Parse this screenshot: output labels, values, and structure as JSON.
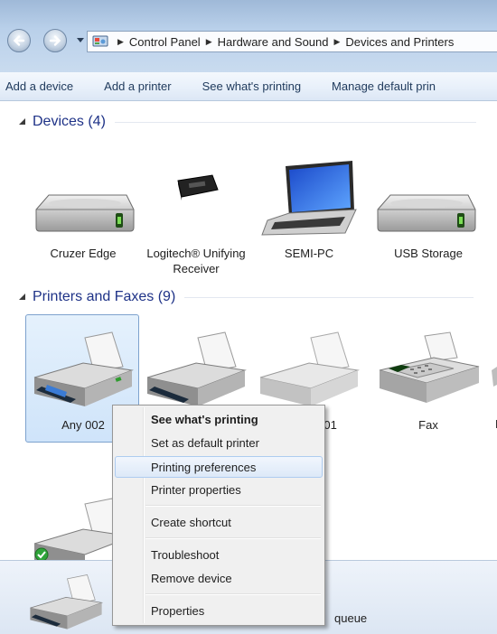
{
  "address_bar": {
    "crumbs": [
      "Control Panel",
      "Hardware and Sound",
      "Devices and Printers"
    ]
  },
  "command_bar": {
    "items": [
      "Add a device",
      "Add a printer",
      "See what's printing",
      "Manage default prin"
    ]
  },
  "devices_group": {
    "header": "Devices (4)",
    "items": [
      {
        "label": "Cruzer Edge",
        "icon": "usb-drive-icon"
      },
      {
        "label": "Logitech® Unifying Receiver",
        "icon": "usb-receiver-icon"
      },
      {
        "label": "SEMI-PC",
        "icon": "laptop-icon"
      },
      {
        "label": "USB Storage",
        "icon": "usb-drive-icon"
      }
    ]
  },
  "printers_group": {
    "header": "Printers and Faxes (9)",
    "items": [
      {
        "label": "Any 002",
        "icon": "printer-icon",
        "selected": true
      },
      {
        "label": "",
        "icon": "printer-icon"
      },
      {
        "label": "001",
        "icon": "printer-icon"
      },
      {
        "label": "Fax",
        "icon": "fax-icon"
      },
      {
        "label": "F",
        "icon": "printer-icon"
      }
    ]
  },
  "context_menu": {
    "items": [
      {
        "label": "See what's printing",
        "bold": true
      },
      {
        "label": "Set as default printer"
      },
      {
        "label": "Printing preferences",
        "highlighted": true
      },
      {
        "label": "Printer properties"
      },
      {
        "label": "Create shortcut"
      },
      {
        "label": "Troubleshoot"
      },
      {
        "label": "Remove device"
      },
      {
        "label": "Properties"
      }
    ]
  },
  "details_pane": {
    "text": "queue"
  },
  "colors": {
    "group_header": "#1e3287",
    "command_text": "#1e395b",
    "selection_border": "#7da2ce"
  }
}
